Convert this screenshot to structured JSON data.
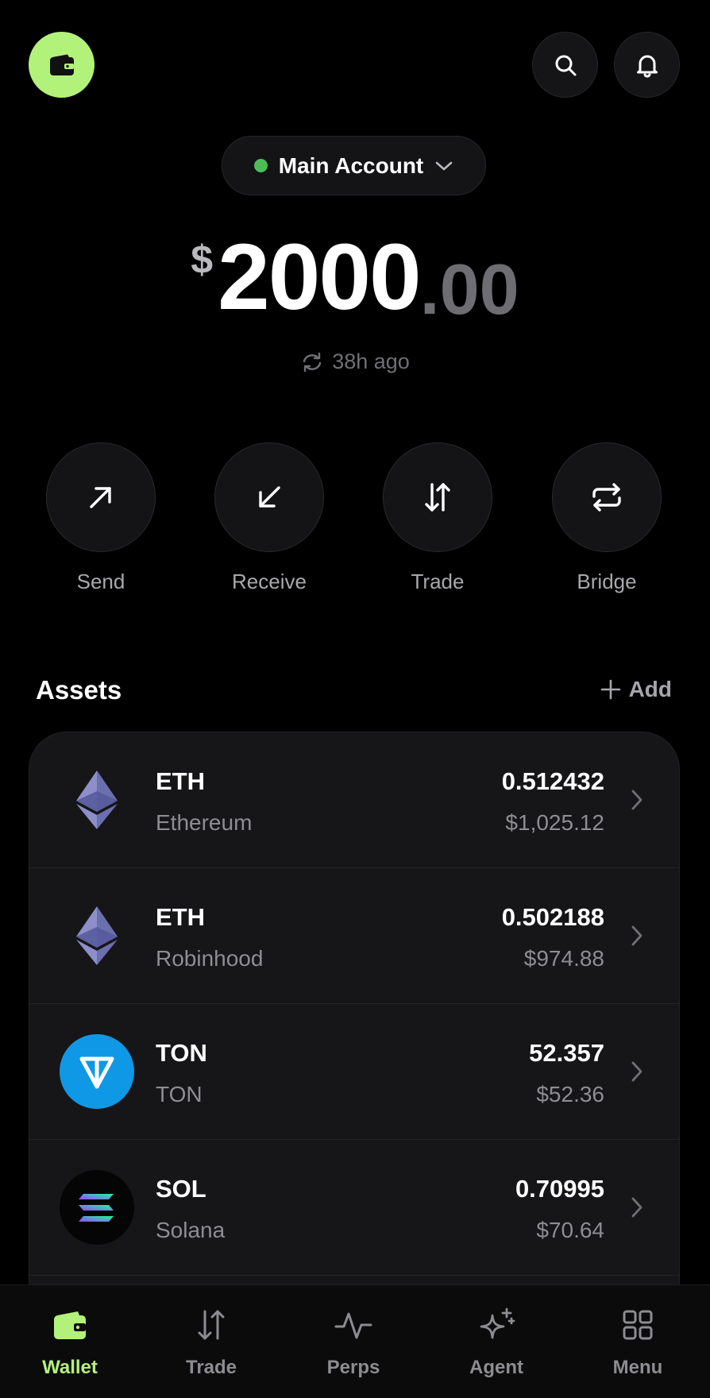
{
  "header": {
    "account_name": "Main Account",
    "account_status_color": "#4dbd58",
    "accent_color": "#b3f27a",
    "icons": [
      "wallet-icon",
      "search-icon",
      "bell-icon",
      "chevron-down-icon"
    ]
  },
  "balance": {
    "currency": "$",
    "integer": "2000",
    "decimal": ".00",
    "last_sync": "38h ago"
  },
  "actions": [
    {
      "label": "Send",
      "icon": "arrow-up-right-icon"
    },
    {
      "label": "Receive",
      "icon": "arrow-down-left-icon"
    },
    {
      "label": "Trade",
      "icon": "swap-vertical-icon"
    },
    {
      "label": "Bridge",
      "icon": "repeat-icon"
    }
  ],
  "assets": {
    "title": "Assets",
    "add_label": "Add",
    "items": [
      {
        "symbol": "ETH",
        "name": "Ethereum",
        "amount": "0.512432",
        "value": "$1,025.12",
        "icon": "ethereum-icon"
      },
      {
        "symbol": "ETH",
        "name": "Robinhood",
        "amount": "0.502188",
        "value": "$974.88",
        "icon": "ethereum-icon"
      },
      {
        "symbol": "TON",
        "name": "TON",
        "amount": "52.357",
        "value": "$52.36",
        "icon": "ton-icon",
        "icon_color": "#0f98e6"
      },
      {
        "symbol": "SOL",
        "name": "Solana",
        "amount": "0.70995",
        "value": "$70.64",
        "icon": "solana-icon"
      }
    ]
  },
  "nav": {
    "items": [
      {
        "label": "Wallet",
        "icon": "wallet-icon",
        "active": true
      },
      {
        "label": "Trade",
        "icon": "swap-vertical-icon",
        "active": false
      },
      {
        "label": "Perps",
        "icon": "pulse-icon",
        "active": false
      },
      {
        "label": "Agent",
        "icon": "sparkle-icon",
        "active": false
      },
      {
        "label": "Menu",
        "icon": "grid-icon",
        "active": false
      }
    ]
  }
}
